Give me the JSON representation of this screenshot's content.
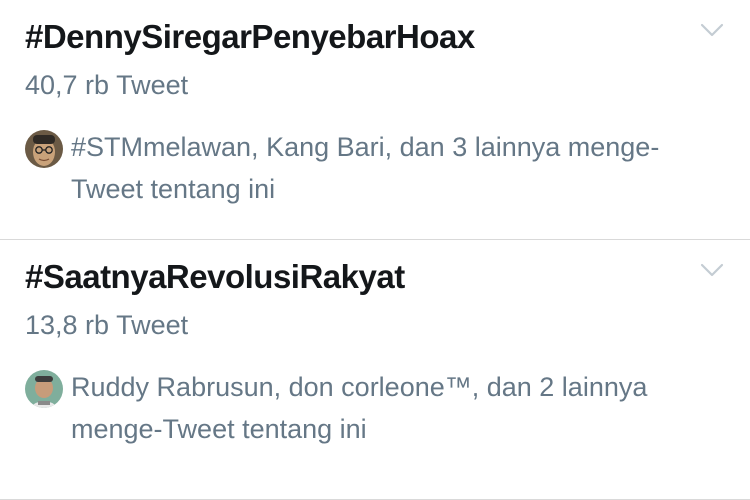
{
  "trends": [
    {
      "hashtag": "#DennySiregarPenyebarHoax",
      "count": "40,7 rb Tweet",
      "context": "#STMmelawan, Kang Bari, dan 3 lainnya menge-Tweet tentang ini",
      "avatar_icon": "user-avatar-glasses"
    },
    {
      "hashtag": "#SaatnyaRevolusiRakyat",
      "count": "13,8 rb Tweet",
      "context": "Ruddy Rabrusun, don corleone™, dan 2 lainnya menge-Tweet tentang ini",
      "avatar_icon": "user-avatar-cap"
    }
  ],
  "colors": {
    "hashtag_text": "#14171a",
    "secondary_text": "#657786",
    "divider": "#d9d9d9",
    "chevron": "#aab8c2"
  }
}
